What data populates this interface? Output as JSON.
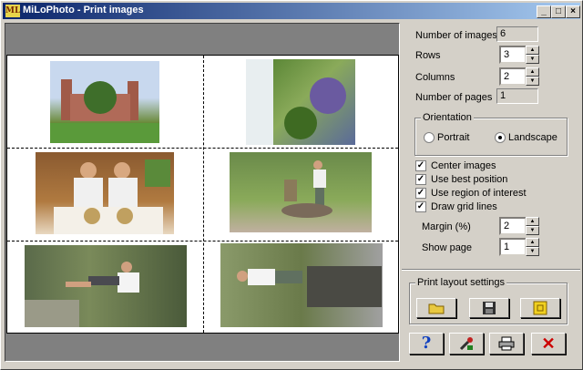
{
  "window": {
    "title": "MiLoPhoto - Print images",
    "app_icon": "ML"
  },
  "controls": {
    "minimize": "_",
    "maximize": "□",
    "close": "×"
  },
  "settings": {
    "number_of_images_label": "Number of images",
    "number_of_images": "6",
    "rows_label": "Rows",
    "rows": "3",
    "columns_label": "Columns",
    "columns": "2",
    "number_of_pages_label": "Number of pages",
    "number_of_pages": "1",
    "orientation_label": "Orientation",
    "portrait_label": "Portrait",
    "landscape_label": "Landscape",
    "orientation_selected": "Landscape",
    "center_images_label": "Center images",
    "use_best_position_label": "Use best position",
    "use_region_label": "Use region of interest",
    "draw_grid_label": "Draw grid lines",
    "margin_label": "Margin (%)",
    "margin": "2",
    "show_page_label": "Show page",
    "show_page": "1",
    "print_layout_label": "Print layout settings"
  },
  "icons": [
    "open-folder-icon",
    "save-disk-icon",
    "refresh-layout-icon",
    "help-icon",
    "tools-icon",
    "printer-icon",
    "close-x-icon"
  ],
  "colors": {
    "title_start": "#0a246a",
    "title_end": "#a6caf0",
    "help": "#1040c0",
    "close": "#cc0000"
  }
}
